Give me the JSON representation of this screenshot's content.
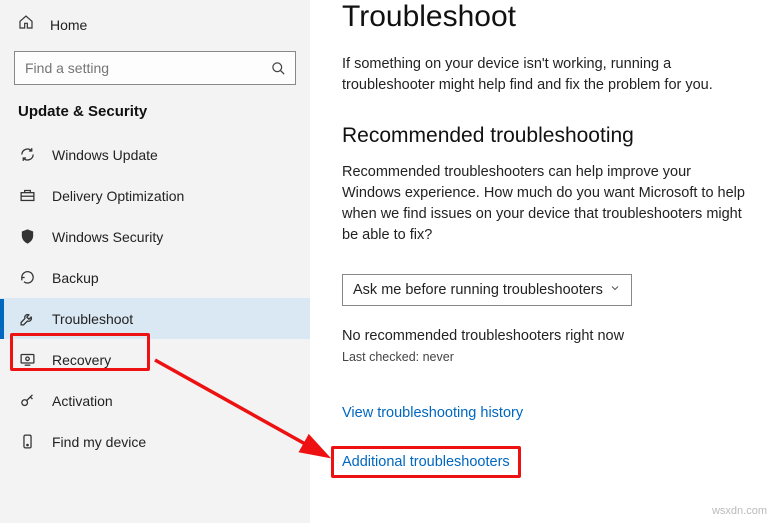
{
  "sidebar": {
    "home": "Home",
    "search_placeholder": "Find a setting",
    "section": "Update & Security",
    "items": [
      {
        "label": "Windows Update"
      },
      {
        "label": "Delivery Optimization"
      },
      {
        "label": "Windows Security"
      },
      {
        "label": "Backup"
      },
      {
        "label": "Troubleshoot"
      },
      {
        "label": "Recovery"
      },
      {
        "label": "Activation"
      },
      {
        "label": "Find my device"
      }
    ]
  },
  "main": {
    "title": "Troubleshoot",
    "intro": "If something on your device isn't working, running a troubleshooter might help find and fix the problem for you.",
    "rec_title": "Recommended troubleshooting",
    "rec_desc": "Recommended troubleshooters can help improve your Windows experience. How much do you want Microsoft to help when we find issues on your device that troubleshooters might be able to fix?",
    "dropdown_value": "Ask me before running troubleshooters",
    "status": "No recommended troubleshooters right now",
    "last_checked": "Last checked: never",
    "link_history": "View troubleshooting history",
    "link_additional": "Additional troubleshooters"
  },
  "watermark": "wsxdn.com"
}
